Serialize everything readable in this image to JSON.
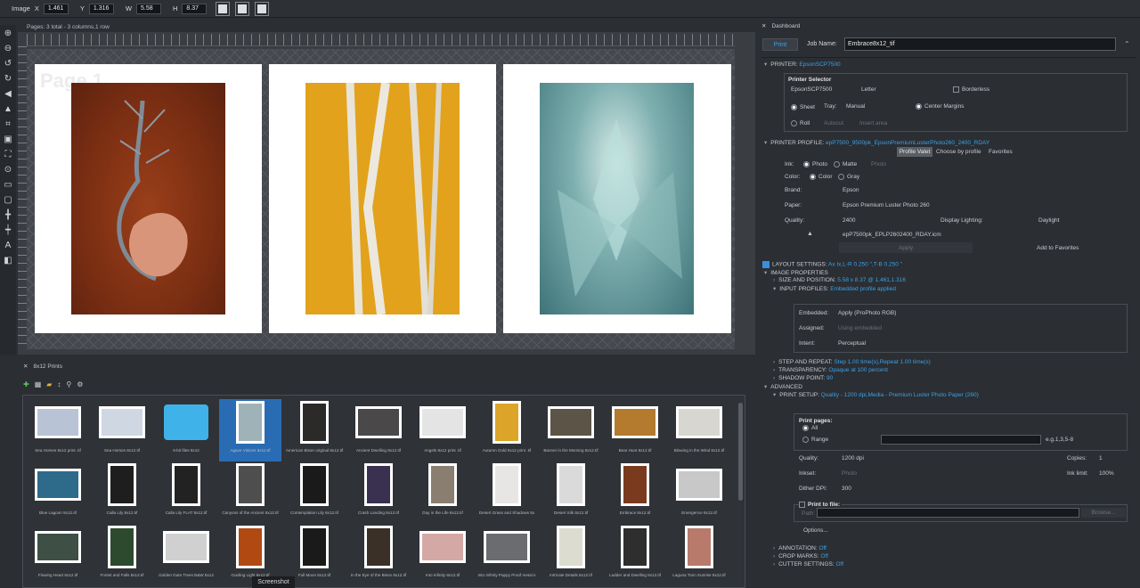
{
  "topbar": {
    "image_label": "Image",
    "x_label": "X",
    "x_value": "1.461",
    "y_label": "Y",
    "y_value": "1.316",
    "w_label": "W",
    "w_value": "5.58",
    "h_label": "H",
    "h_value": "8.37"
  },
  "canvas": {
    "pages_info": "Pages: 3 total - 3 columns,1 row",
    "watermark": "Page 1"
  },
  "dashboard": {
    "title": "Dashboard",
    "print_tab": "Print",
    "job_name_label": "Job Name:",
    "job_name_value": "Embrace8x12_tif",
    "printer": {
      "label": "PRINTER:",
      "value": "EpsonSCP7500"
    },
    "printer_selector": {
      "title": "Printer Selector",
      "printer": "EpsonSCP7500",
      "paper_size": "Letter",
      "borderless": "Borderless",
      "sheet": "Sheet",
      "tray_label": "Tray:",
      "tray_value": "Manual",
      "center_margins": "Center Margins",
      "roll": "Roll",
      "autocut": "Autocut",
      "insert_area": "Insert area"
    },
    "profile": {
      "label": "PRINTER PROFILE:",
      "value": "epP7500_9500pk_EpsonPremiumLusterPhoto260_2400_RDAY",
      "profile_valet": "Profile Valet",
      "choose_by_profile": "Choose by profile",
      "favorites": "Favorites",
      "ink_label": "Ink:",
      "ink_photo": "Photo",
      "ink_matte": "Matte",
      "ink_photo2": "Photo",
      "color_label": "Color:",
      "color_color": "Color",
      "color_gray": "Gray",
      "brand_label": "Brand:",
      "brand_value": "Epson",
      "paper_label": "Paper:",
      "paper_value": "Epson Premium Luster Photo 260",
      "quality_label": "Quality:",
      "quality_value": "2400",
      "display_lighting_label": "Display Lighting:",
      "display_lighting_value": "Daylight",
      "icc_file": "epP7500pk_EPLP2602400_RDAY.icm",
      "apply": "Apply",
      "add_to_favorites": "Add to Favorites"
    },
    "layout": {
      "label": "LAYOUT SETTINGS:",
      "value": "Ax Ix,L-R 0.250 \",T-B 0.250 \"",
      "image_properties": "IMAGE PROPERTIES",
      "size_position_label": "SIZE AND POSITION:",
      "size_position_value": "5.58 x 8.37 @ 1.461,1.316",
      "input_profiles_label": "INPUT PROFILES:",
      "input_profiles_value": "Embedded profile applied",
      "embedded_label": "Embedded:",
      "embedded_value": "Apply (ProPhoto RGB)",
      "assigned_label": "Assigned:",
      "assigned_value": "Using embedded",
      "intent_label": "Intent:",
      "intent_value": "Perceptual",
      "step_repeat_label": "STEP AND REPEAT:",
      "step_repeat_value": "Step 1.00 time(s),Repeat 1.00 time(s)",
      "transparency_label": "TRANSPARENCY:",
      "transparency_value": "Opaque at 100 percent",
      "shadow_label": "SHADOW POINT:",
      "shadow_value": "90"
    },
    "advanced": {
      "label": "ADVANCED",
      "print_setup_label": "PRINT SETUP:",
      "print_setup_value": "Quality - 1200 dpi,Media - Premium Luster Photo Paper (260)",
      "print_pages": "Print pages:",
      "all": "All",
      "range": "Range",
      "range_hint": "e.g.1,3,5-8",
      "quality_label": "Quality:",
      "quality_value": "1200 dpi",
      "copies_label": "Copies:",
      "copies_value": "1",
      "inkset_label": "Inkset:",
      "inkset_value": "Photo",
      "ink_limit_label": "Ink limit:",
      "ink_limit_value": "100%",
      "dither_label": "Dither DPI:",
      "dither_value": "300",
      "print_to_file": "Print to file:",
      "path_label": "Path:",
      "browse": "Browse...",
      "options": "Options...",
      "annotation_label": "ANNOTATION:",
      "annotation_value": "Off",
      "crop_label": "CROP MARKS:",
      "crop_value": "Off",
      "cutter_label": "CUTTER SETTINGS:",
      "cutter_value": "Off"
    }
  },
  "browser": {
    "title": "8x12 Prints",
    "tooltip": "Screenshot",
    "thumbs": [
      {
        "caption": "Sea Horses 8x12 print .tif",
        "color": "#b9c3d6"
      },
      {
        "caption": "Sea Horses 8x12.tif",
        "color": "#cfd7e3"
      },
      {
        "caption": "6-bit files 8x12",
        "color": "#3fb2ea"
      },
      {
        "caption": "Agave Visions 8x12.tif",
        "color": "#9fb2b8"
      },
      {
        "caption": "American Bison original 8x12.tif",
        "color": "#2c2a28"
      },
      {
        "caption": "Ancient Dwelling 8x12.tif",
        "color": "#4a4848"
      },
      {
        "caption": "Angels 8x12 print .tif",
        "color": "#e4e4e4"
      },
      {
        "caption": "Autumn Gold 8x12 print .tif",
        "color": "#dca52a"
      },
      {
        "caption": "Banner in the Morning 8x12.tif",
        "color": "#5c5446"
      },
      {
        "caption": "Bear Hunt 8x12.tif",
        "color": "#b47a2e"
      },
      {
        "caption": "Blowing in the Wind 8x12.tif",
        "color": "#d8d6d0"
      },
      {
        "caption": "Blue Lagoon 8x12.tif",
        "color": "#2e6a8a"
      },
      {
        "caption": "Calla Lily 8x12.tif",
        "color": "#1e1e1e"
      },
      {
        "caption": "Calla Lily FLAT 8x12.tif",
        "color": "#222222"
      },
      {
        "caption": "Canyons of the Ancient 8x12.tif",
        "color": "#4e4e4e"
      },
      {
        "caption": "Contemplation Lily 8x12.tif",
        "color": "#1a1a1a"
      },
      {
        "caption": "Crash Landing 8x12.tif",
        "color": "#3a3050"
      },
      {
        "caption": "Day in the Life 8x12.tif",
        "color": "#8a7e70"
      },
      {
        "caption": "Desert Grass and Shadows 8x",
        "color": "#e8e6e4"
      },
      {
        "caption": "Desert Silk 8x12.tif",
        "color": "#dadada"
      },
      {
        "caption": "Embrace 8x12.tif",
        "color": "#7a3a1e"
      },
      {
        "caption": "Emergence 8x12.tif",
        "color": "#c8c8c8"
      },
      {
        "caption": "Flowing Heart 8x12.tif",
        "color": "#3e5046"
      },
      {
        "caption": "Forest and Falls 8x12.tif",
        "color": "#2e4a2e"
      },
      {
        "caption": "Golden Gate Trees B&W 8x12",
        "color": "#d0d0d0"
      },
      {
        "caption": "Guiding Light 8x12.tif",
        "color": "#b04a12"
      },
      {
        "caption": "Full Moon 8x12.tif",
        "color": "#1a1a1a"
      },
      {
        "caption": "In the Eye of the Bison 8x12.tif",
        "color": "#3a3028"
      },
      {
        "caption": "Into Infinity 8x12.tif",
        "color": "#d4a8a4"
      },
      {
        "caption": "Into Infinity Pappy Proof metal e",
        "color": "#6a6c70"
      },
      {
        "caption": "Intricate Details 8x12.tif",
        "color": "#dcdcd0"
      },
      {
        "caption": "Ladder and Dwelling 8x12.tif",
        "color": "#2e2e2e"
      },
      {
        "caption": "Laguna Tonn Sunrise 8x12.tif",
        "color": "#b87a6a"
      }
    ]
  }
}
